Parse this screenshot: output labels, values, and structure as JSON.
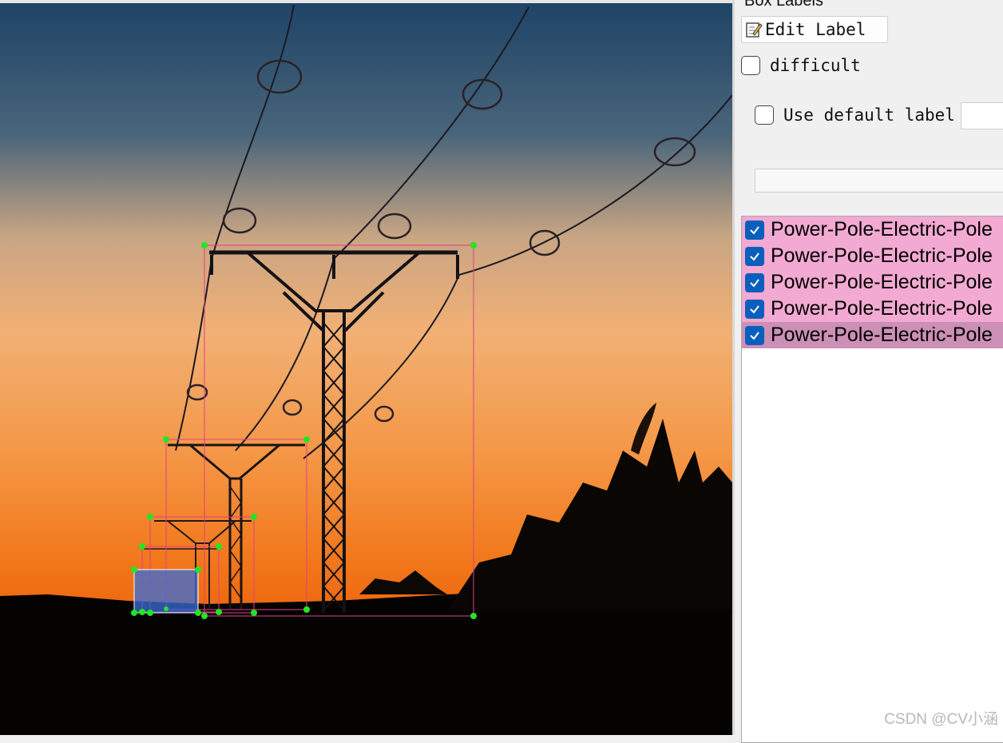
{
  "dock_title": "Box Labels",
  "edit_label_button": "Edit Label",
  "difficult_label": "difficult",
  "use_default_label": "Use default label",
  "label_items": [
    {
      "label": "Power-Pole-Electric-Pole",
      "checked": true,
      "selected": false
    },
    {
      "label": "Power-Pole-Electric-Pole",
      "checked": true,
      "selected": false
    },
    {
      "label": "Power-Pole-Electric-Pole",
      "checked": true,
      "selected": false
    },
    {
      "label": "Power-Pole-Electric-Pole",
      "checked": true,
      "selected": false
    },
    {
      "label": "Power-Pole-Electric-Pole",
      "checked": true,
      "selected": true
    }
  ],
  "watermark": "CSDN @CV小涵",
  "colors": {
    "box_outline": "#e0408a",
    "vertex_handle": "#22e622",
    "selected_box_fill": "#3a6ed8",
    "label_row_bg": "#f2a9d2",
    "label_row_selected_bg": "#cc8fb6",
    "checkbox_checked": "#0a5fbd"
  }
}
